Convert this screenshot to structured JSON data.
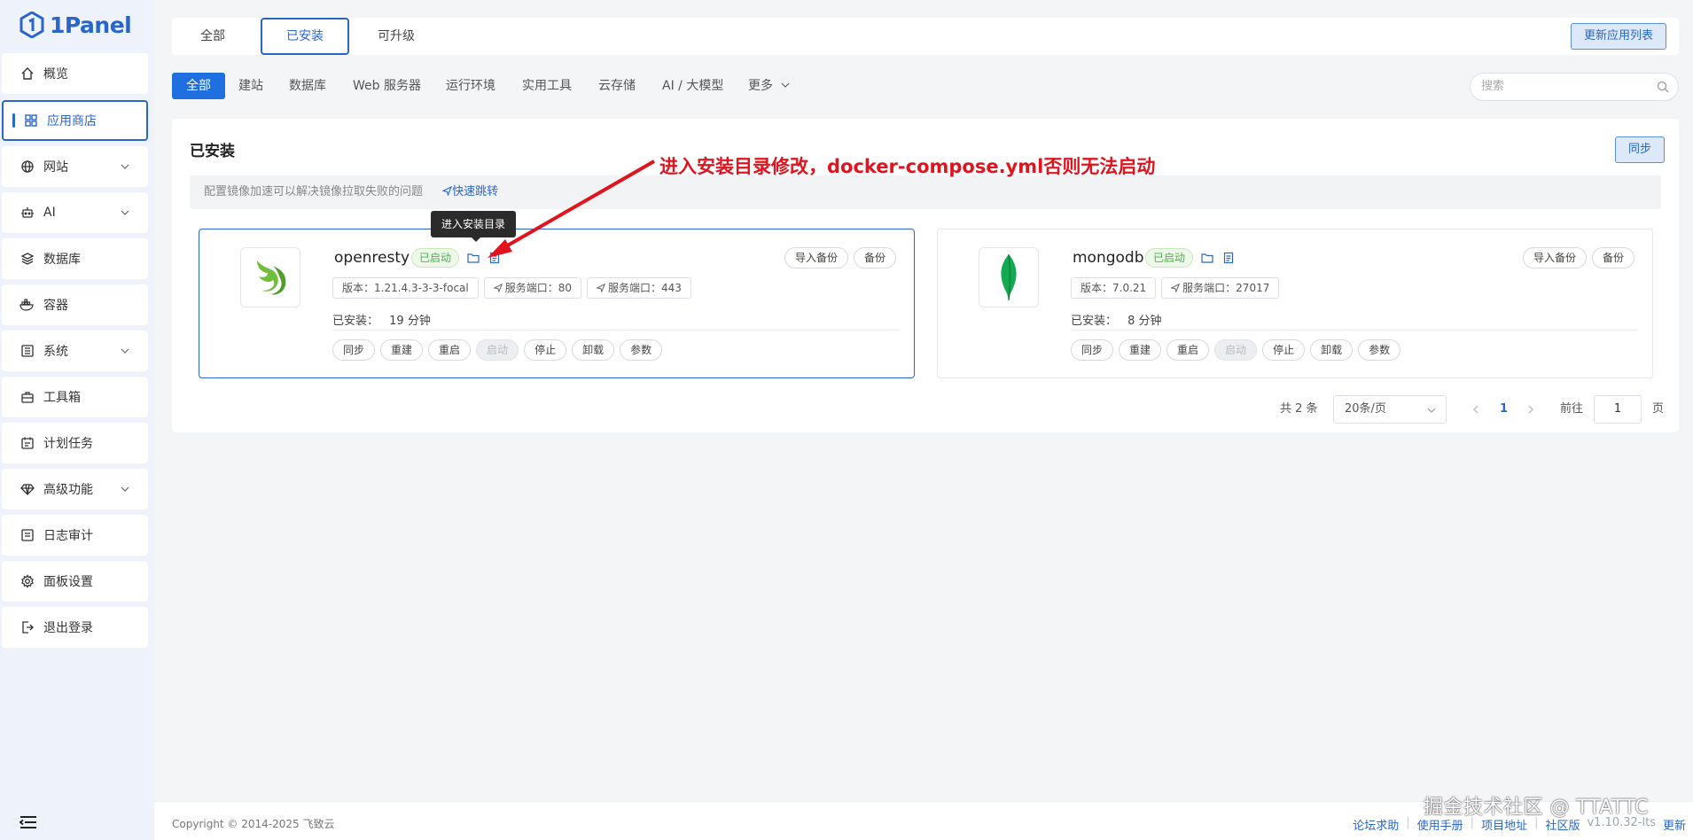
{
  "brand": {
    "name": "1Panel"
  },
  "sidebar": {
    "items": [
      {
        "label": "概览",
        "icon": "home-icon"
      },
      {
        "label": "应用商店",
        "icon": "grid-icon",
        "active": true
      },
      {
        "label": "网站",
        "icon": "globe-icon",
        "has_submenu": true
      },
      {
        "label": "AI",
        "icon": "robot-icon",
        "has_submenu": true
      },
      {
        "label": "数据库",
        "icon": "layers-icon"
      },
      {
        "label": "容器",
        "icon": "docker-icon"
      },
      {
        "label": "系统",
        "icon": "system-icon",
        "has_submenu": true
      },
      {
        "label": "工具箱",
        "icon": "toolbox-icon"
      },
      {
        "label": "计划任务",
        "icon": "calendar-icon"
      },
      {
        "label": "高级功能",
        "icon": "diamond-icon",
        "has_submenu": true
      },
      {
        "label": "日志审计",
        "icon": "log-icon"
      },
      {
        "label": "面板设置",
        "icon": "gear-icon"
      },
      {
        "label": "退出登录",
        "icon": "logout-icon"
      }
    ]
  },
  "top_tabs": [
    {
      "label": "全部"
    },
    {
      "label": "已安装",
      "active": true
    },
    {
      "label": "可升级"
    }
  ],
  "refresh_label": "更新应用列表",
  "filters": [
    {
      "label": "全部",
      "active": true
    },
    {
      "label": "建站"
    },
    {
      "label": "数据库"
    },
    {
      "label": "Web 服务器"
    },
    {
      "label": "运行环境"
    },
    {
      "label": "实用工具"
    },
    {
      "label": "云存储"
    },
    {
      "label": "AI / 大模型"
    },
    {
      "label": "更多"
    }
  ],
  "search": {
    "placeholder": "搜索"
  },
  "panel": {
    "title": "已安装",
    "sync_label": "同步",
    "notice": "配置镜像加速可以解决镜像拉取失败的问题",
    "notice_link": "快速跳转"
  },
  "annotation": "进入安装目录修改，docker-compose.yml否则无法启动",
  "tooltip": "进入安装目录",
  "apps": [
    {
      "name": "openresty",
      "status": "已启动",
      "version": "版本：1.21.4.3-3-3-focal",
      "ports": [
        "服务端口：80",
        "服务端口：443"
      ],
      "installed": "已安装：",
      "installed_time": "19 分钟",
      "top_buttons": [
        "导入备份",
        "备份"
      ],
      "actions": [
        "同步",
        "重建",
        "重启",
        "启动",
        "停止",
        "卸载",
        "参数"
      ]
    },
    {
      "name": "mongodb",
      "status": "已启动",
      "version": "版本：7.0.21",
      "ports": [
        "服务端口：27017"
      ],
      "installed": "已安装：",
      "installed_time": "8 分钟",
      "top_buttons": [
        "导入备份",
        "备份"
      ],
      "actions": [
        "同步",
        "重建",
        "重启",
        "启动",
        "停止",
        "卸载",
        "参数"
      ]
    }
  ],
  "pagination": {
    "total": "共 2 条",
    "page_size": "20条/页",
    "current": "1",
    "goto_label": "前往",
    "goto_value": "1",
    "page_suffix": "页"
  },
  "footer": {
    "copyright": "Copyright © 2014-2025 飞致云",
    "links": [
      "论坛求助",
      "使用手册",
      "项目地址",
      "社区版"
    ],
    "version": "v1.10.32-lts",
    "update": "更新"
  },
  "watermark": "掘金技术社区 @ TTATTC",
  "colors": {
    "primary": "#2a66c8",
    "accent": "#1f6fe0",
    "annotation": "#e0141e",
    "running": "#4caf50"
  }
}
